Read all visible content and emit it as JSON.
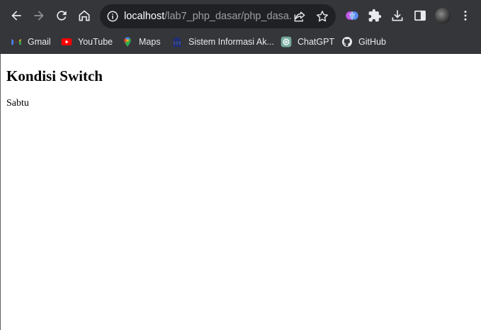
{
  "browser": {
    "url_host": "localhost",
    "url_path": "/lab7_php_dasar/php_dasa...",
    "colors": {
      "frame": "#35363a",
      "omnibox": "#202124",
      "icon": "#e8eaed",
      "url_path": "#9aa0a6"
    }
  },
  "bookmarks": [
    {
      "label": "Gmail",
      "icon": "gmail-icon"
    },
    {
      "label": "YouTube",
      "icon": "youtube-icon"
    },
    {
      "label": "Maps",
      "icon": "maps-icon"
    },
    {
      "label": "Sistem Informasi Ak...",
      "icon": "university-icon"
    },
    {
      "label": "ChatGPT",
      "icon": "chatgpt-icon"
    },
    {
      "label": "GitHub",
      "icon": "github-icon"
    }
  ],
  "page": {
    "title": "Kondisi Switch",
    "result": "Sabtu"
  }
}
